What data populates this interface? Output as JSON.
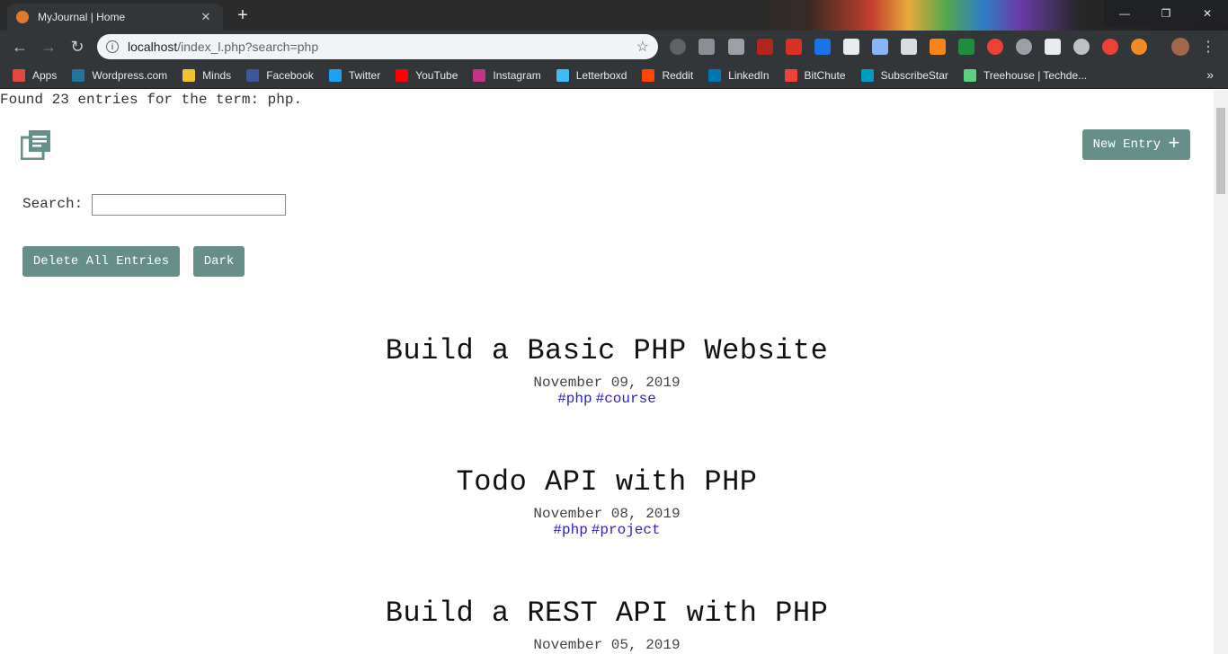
{
  "browser": {
    "tab_title": "MyJournal | Home",
    "tab_close": "✕",
    "new_tab": "+",
    "url_host": "localhost",
    "url_path": "/index_l.php?search=php",
    "win_minimize": "—",
    "win_restore": "❐",
    "win_close": "✕",
    "bookmarks": [
      {
        "label": "Apps",
        "icon": "apps-grid-icon",
        "color": "#e04a3a"
      },
      {
        "label": "Wordpress.com",
        "icon": "wordpress-icon",
        "color": "#21759b"
      },
      {
        "label": "Minds",
        "icon": "minds-bulb-icon",
        "color": "#f2c12e"
      },
      {
        "label": "Facebook",
        "icon": "facebook-icon",
        "color": "#3b5998"
      },
      {
        "label": "Twitter",
        "icon": "twitter-icon",
        "color": "#1da1f2"
      },
      {
        "label": "YouTube",
        "icon": "youtube-icon",
        "color": "#ff0000"
      },
      {
        "label": "Instagram",
        "icon": "instagram-icon",
        "color": "#c13584"
      },
      {
        "label": "Letterboxd",
        "icon": "letterboxd-icon",
        "color": "#40bcf4"
      },
      {
        "label": "Reddit",
        "icon": "reddit-icon",
        "color": "#ff4500"
      },
      {
        "label": "LinkedIn",
        "icon": "linkedin-icon",
        "color": "#0077b5"
      },
      {
        "label": "BitChute",
        "icon": "bitchute-icon",
        "color": "#ef4137"
      },
      {
        "label": "SubscribeStar",
        "icon": "subscribestar-icon",
        "color": "#009cc3"
      },
      {
        "label": "Treehouse | Techde...",
        "icon": "treehouse-icon",
        "color": "#5fcf80"
      }
    ],
    "bookmarks_more": "»"
  },
  "page": {
    "found_text": "Found 23 entries for the term: php.",
    "new_entry_label": "New Entry",
    "new_entry_plus": "+",
    "search_label": "Search:",
    "search_value": "",
    "delete_all_label": "Delete All Entries",
    "dark_label": "Dark",
    "accent_color": "#678f89",
    "tag_color": "#2b1fbd"
  },
  "entries": [
    {
      "title": "Build a Basic PHP Website",
      "date": "November 09, 2019",
      "tags": [
        "#php",
        "#course"
      ]
    },
    {
      "title": "Todo API with PHP",
      "date": "November 08, 2019",
      "tags": [
        "#php",
        "#project"
      ]
    },
    {
      "title": "Build a REST API with PHP",
      "date": "November 05, 2019",
      "tags": []
    }
  ]
}
